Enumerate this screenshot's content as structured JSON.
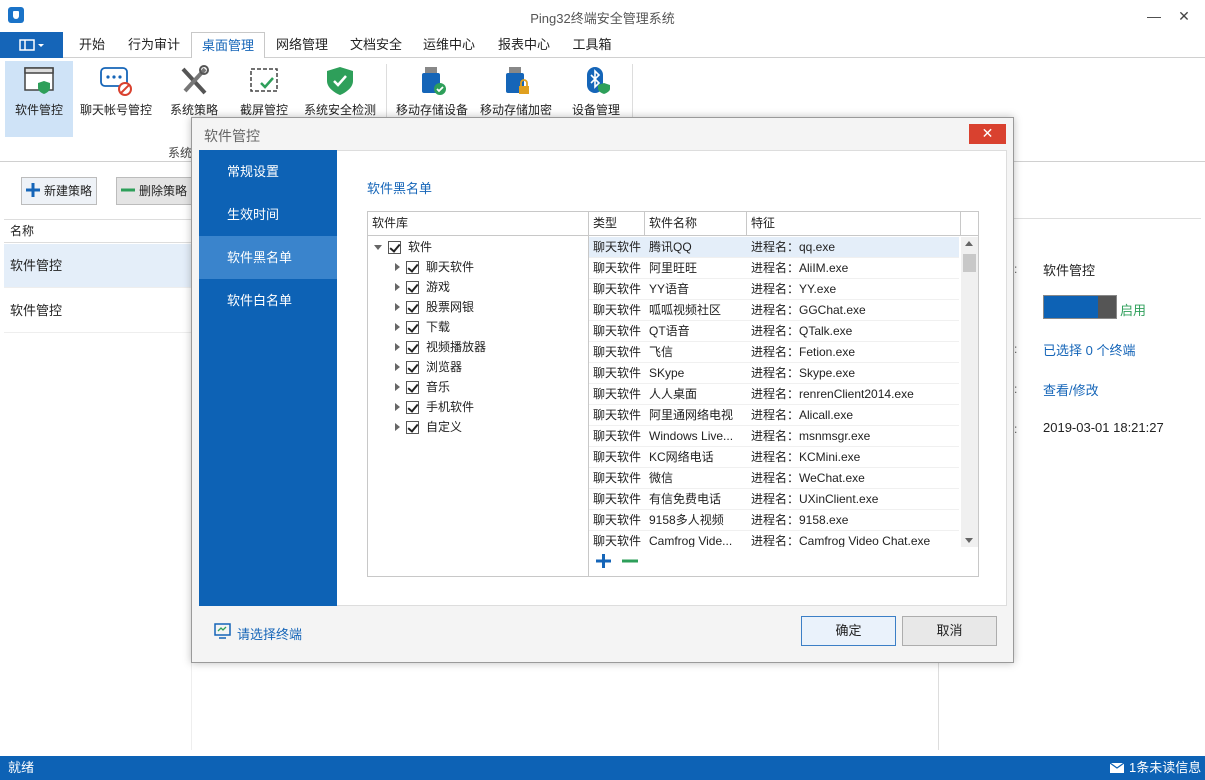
{
  "window": {
    "title": "Ping32终端安全管理系统"
  },
  "menu_tabs": [
    "开始",
    "行为审计",
    "桌面管理",
    "网络管理",
    "文档安全",
    "运维中心",
    "报表中心",
    "工具箱"
  ],
  "ribbon": {
    "buttons": [
      "软件管控",
      "聊天帐号管控",
      "系统策略",
      "截屏管控",
      "系统安全检测",
      "移动存储设备",
      "移动存储加密",
      "设备管理"
    ],
    "group_label": "系统"
  },
  "toolbar": {
    "new_policy": "新建策略",
    "delete_policy": "删除策略"
  },
  "policy_list": {
    "header": "名称",
    "rows": [
      "软件管控",
      "软件管控"
    ]
  },
  "right_panel": {
    "name_value": "软件管控",
    "toggle_label": "启用",
    "terminals_link": "已选择 0 个终端",
    "view_link": "查看/修改",
    "time_value": "2019-03-01 18:21:27"
  },
  "dialog": {
    "title": "软件管控",
    "close": "✕",
    "side_items": [
      "常规设置",
      "生效时间",
      "软件黑名单",
      "软件白名单"
    ],
    "section_title": "软件黑名单",
    "tree_header": "软件库",
    "tree_root": "软件",
    "tree_children": [
      "聊天软件",
      "游戏",
      "股票网银",
      "下载",
      "视频播放器",
      "浏览器",
      "音乐",
      "手机软件",
      "自定义"
    ],
    "grid_headers": [
      "类型",
      "软件名称",
      "特征"
    ],
    "grid_rows": [
      [
        "聊天软件",
        "腾讯QQ",
        "进程名：qq.exe"
      ],
      [
        "聊天软件",
        "阿里旺旺",
        "进程名：AliIM.exe"
      ],
      [
        "聊天软件",
        "YY语音",
        "进程名：YY.exe"
      ],
      [
        "聊天软件",
        "呱呱视频社区",
        "进程名：GGChat.exe"
      ],
      [
        "聊天软件",
        "QT语音",
        "进程名：QTalk.exe"
      ],
      [
        "聊天软件",
        "飞信",
        "进程名：Fetion.exe"
      ],
      [
        "聊天软件",
        "SKype",
        "进程名：Skype.exe"
      ],
      [
        "聊天软件",
        "人人桌面",
        "进程名：renrenClient2014.exe"
      ],
      [
        "聊天软件",
        "阿里通网络电视",
        "进程名：Alicall.exe"
      ],
      [
        "聊天软件",
        "Windows Live...",
        "进程名：msnmsgr.exe"
      ],
      [
        "聊天软件",
        "KC网络电话",
        "进程名：KCMini.exe"
      ],
      [
        "聊天软件",
        "微信",
        "进程名：WeChat.exe"
      ],
      [
        "聊天软件",
        "有信免费电话",
        "进程名：UXinClient.exe"
      ],
      [
        "聊天软件",
        "9158多人视频",
        "进程名：9158.exe"
      ],
      [
        "聊天软件",
        "Camfrog Vide...",
        "进程名：Camfrog Video Chat.exe"
      ]
    ],
    "select_terminal": "请选择终端",
    "ok": "确定",
    "cancel": "取消"
  },
  "status": {
    "left": "就绪",
    "right": "1条未读信息"
  }
}
